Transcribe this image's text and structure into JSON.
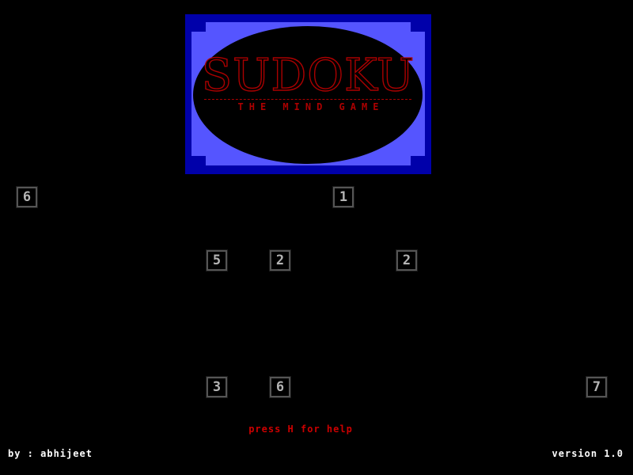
{
  "banner": {
    "title": "SUDOKU",
    "subtitle": "THE MIND GAME"
  },
  "board": {
    "cells": [
      {
        "row": 0,
        "col": 0,
        "value": "6"
      },
      {
        "row": 0,
        "col": 5,
        "value": "1"
      },
      {
        "row": 1,
        "col": 3,
        "value": "5"
      },
      {
        "row": 1,
        "col": 4,
        "value": "2"
      },
      {
        "row": 1,
        "col": 6,
        "value": "2"
      },
      {
        "row": 3,
        "col": 3,
        "value": "3"
      },
      {
        "row": 3,
        "col": 4,
        "value": "6"
      },
      {
        "row": 3,
        "col": 9,
        "value": "7"
      }
    ]
  },
  "footer": {
    "help": "press H for help",
    "credit": "by : abhijeet",
    "version": "version 1.0"
  },
  "colors": {
    "background": "#000000",
    "banner_dark_blue": "#0000aa",
    "banner_light_blue": "#5555ff",
    "title_red": "#aa0000",
    "cell_border": "#555555",
    "cell_text": "#b4b4b4",
    "help_red": "#cc0000",
    "footer_white": "#ffffff"
  }
}
